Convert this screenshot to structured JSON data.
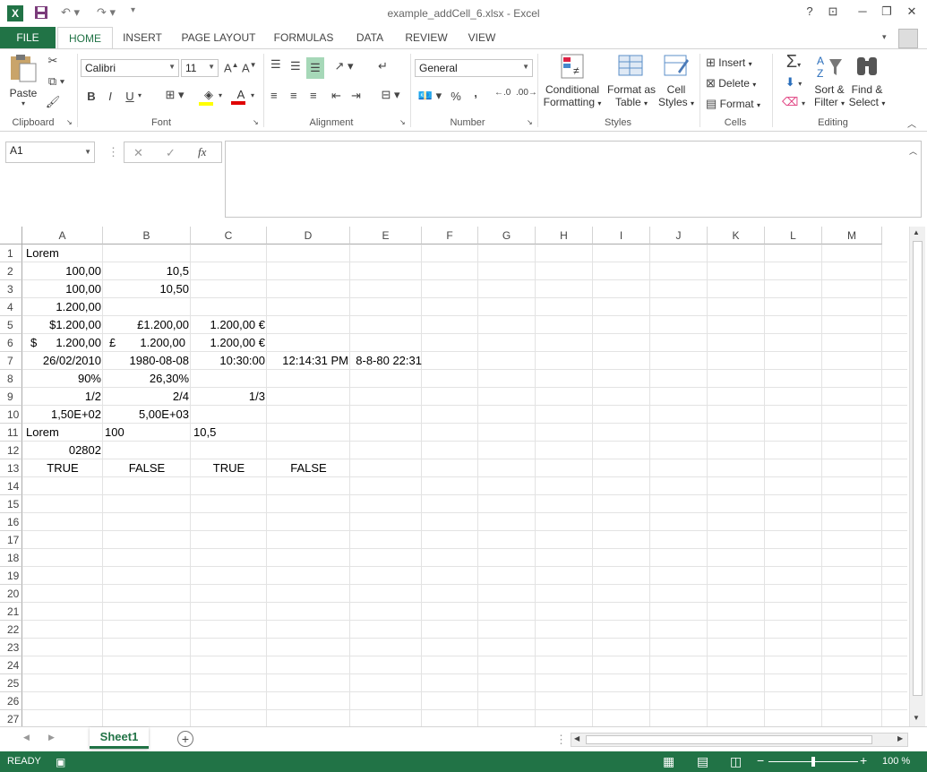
{
  "window": {
    "title": "example_addCell_6.xlsx - Excel",
    "help": "?",
    "minimize": "─",
    "restore": "❐",
    "close": "✕"
  },
  "tabs": [
    "FILE",
    "HOME",
    "INSERT",
    "PAGE LAYOUT",
    "FORMULAS",
    "DATA",
    "REVIEW",
    "VIEW"
  ],
  "ribbon": {
    "clipboard": {
      "paste": "Paste",
      "label": "Clipboard"
    },
    "font": {
      "name": "Calibri",
      "size": "11",
      "label": "Font",
      "bold": "B",
      "italic": "I",
      "underline": "U"
    },
    "alignment": {
      "label": "Alignment"
    },
    "number": {
      "format": "General",
      "label": "Number",
      "percent": "%",
      "comma": ","
    },
    "styles": {
      "conditional1": "Conditional",
      "conditional2": "Formatting",
      "format_table1": "Format as",
      "format_table2": "Table",
      "cell_styles1": "Cell",
      "cell_styles2": "Styles",
      "label": "Styles"
    },
    "cells": {
      "insert": "Insert",
      "delete": "Delete",
      "format": "Format",
      "label": "Cells"
    },
    "editing": {
      "sort1": "Sort &",
      "sort2": "Filter",
      "find1": "Find &",
      "find2": "Select",
      "label": "Editing"
    }
  },
  "formula_bar": {
    "name_box": "A1",
    "fx": "fx",
    "value": ""
  },
  "columns": [
    "A",
    "B",
    "C",
    "D",
    "E",
    "F",
    "G",
    "H",
    "I",
    "J",
    "K",
    "L",
    "M"
  ],
  "rows": [
    "1",
    "2",
    "3",
    "4",
    "5",
    "6",
    "7",
    "8",
    "9",
    "10",
    "11",
    "12",
    "13",
    "14",
    "15",
    "16",
    "17",
    "18",
    "19",
    "20",
    "21",
    "22",
    "23",
    "24",
    "25",
    "26",
    "27"
  ],
  "cells": {
    "A1": "Lorem",
    "A2": "100,00",
    "B2": "10,5",
    "A3": "100,00",
    "B3": "10,50",
    "A4": "1.200,00",
    "A5": "$1.200,00",
    "B5": "£1.200,00",
    "C5": "1.200,00 €",
    "A6_sym": "$",
    "A6": "1.200,00",
    "B6_sym": "£",
    "B6": "1.200,00",
    "C6": "1.200,00 €",
    "A7": "26/02/2010",
    "B7": "1980-08-08",
    "C7": "10:30:00",
    "D7": "12:14:31 PM",
    "E7": "8-8-80 22:31",
    "A8": "90%",
    "B8": "26,30%",
    "A9": "1/2",
    "B9": "2/4",
    "C9": "1/3",
    "A10": "1,50E+02",
    "B10": "5,00E+03",
    "A11": "Lorem",
    "B11": "100",
    "C11": "10,5",
    "A12": "02802",
    "A13": "TRUE",
    "B13": "FALSE",
    "C13": "TRUE",
    "D13": "FALSE"
  },
  "sheets": [
    "Sheet1"
  ],
  "status": {
    "mode": "READY",
    "zoom": "100 %"
  },
  "colors": {
    "accent": "#217346"
  }
}
